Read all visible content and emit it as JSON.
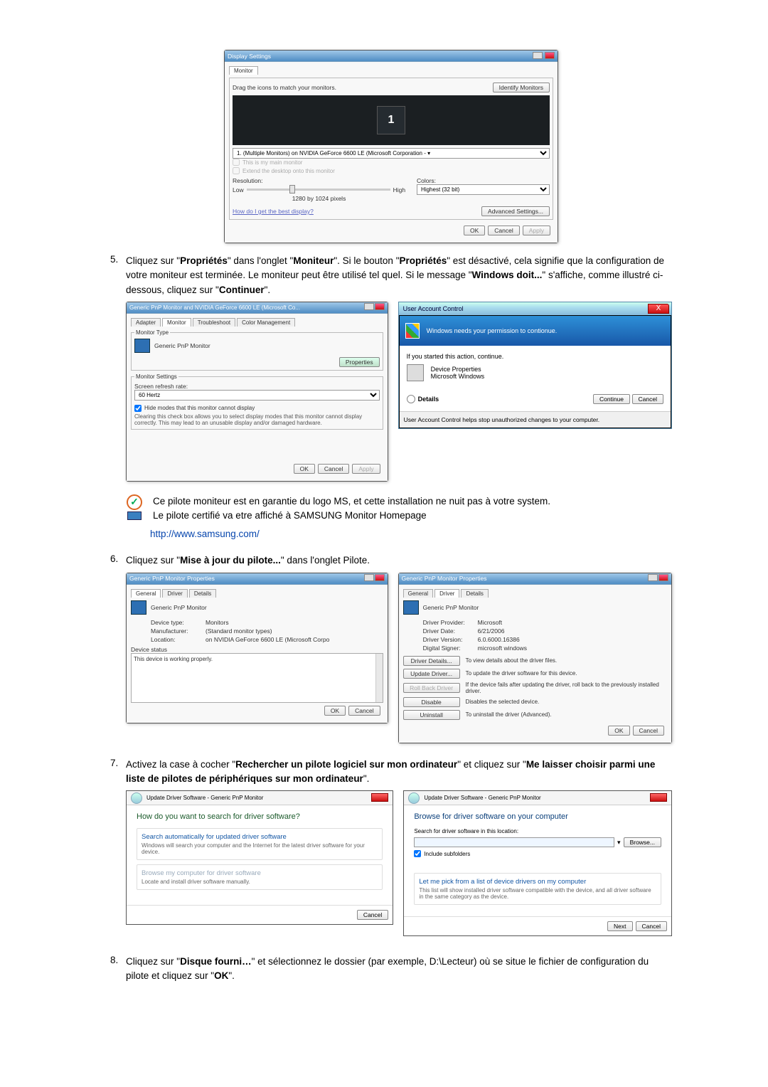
{
  "step4": {
    "screenshot": {
      "window_title": "Display Settings",
      "tab": "Monitor",
      "instruction": "Drag the icons to match your monitors.",
      "identify_btn": "Identify Monitors",
      "monitor_num": "1",
      "selector": "1. (Multiple Monitors) on NVIDIA GeForce 6600 LE (Microsoft Corporation - ▾",
      "chk_main": "This is my main monitor",
      "chk_extend": "Extend the desktop onto this monitor",
      "label_res": "Resolution:",
      "slider_low": "Low",
      "slider_high": "High",
      "res_value": "1280 by 1024 pixels",
      "label_colors": "Colors:",
      "colors_value": "Highest (32 bit)",
      "link_help": "How do I get the best display?",
      "adv_btn": "Advanced Settings...",
      "ok": "OK",
      "cancel": "Cancel",
      "apply": "Apply"
    }
  },
  "step5": {
    "num": "5.",
    "text_pre": "Cliquez sur \"",
    "b1": "Propriétés",
    "mid1": "\" dans l'onglet \"",
    "b2": "Moniteur",
    "mid2": "\". Si le bouton \"",
    "b3": "Propriétés",
    "mid3": "\" est désactivé, cela signifie que la configuration de votre moniteur est terminée. Le moniteur peut être utilisé tel quel. Si le message \"",
    "b4": "Windows doit...",
    "mid4": "\" s'affiche, comme illustré ci-dessous, cliquez sur \"",
    "b5": "Continuer",
    "end": "\".",
    "left": {
      "title": "Generic PnP Monitor and NVIDIA GeForce 6600 LE (Microsoft Co...",
      "tabs": [
        "Adapter",
        "Monitor",
        "Troubleshoot",
        "Color Management"
      ],
      "group_type": "Monitor Type",
      "mon_name": "Generic PnP Monitor",
      "prop_btn": "Properties",
      "group_settings": "Monitor Settings",
      "refresh_label": "Screen refresh rate:",
      "refresh_value": "60 Hertz",
      "chk_hide": "Hide modes that this monitor cannot display",
      "hide_desc": "Clearing this check box allows you to select display modes that this monitor cannot display correctly. This may lead to an unusable display and/or damaged hardware.",
      "ok": "OK",
      "cancel": "Cancel",
      "apply": "Apply"
    },
    "uac": {
      "titlebar": "User Account Control",
      "heading": "Windows needs your permission to contionue.",
      "if_you": "If you started this action, continue.",
      "item_label": "Device Properties",
      "item_sub": "Microsoft Windows",
      "details": "Details",
      "continue": "Continue",
      "cancel": "Cancel",
      "footer": "User Account Control helps stop unauthorized changes to your computer.",
      "x": "X"
    }
  },
  "note": {
    "line1": "Ce pilote moniteur est en garantie du logo MS, et cette installation ne nuit pas à votre system.",
    "line2": "Le pilote certifié va etre affiché à SAMSUNG Monitor Homepage"
  },
  "url": "http://www.samsung.com/",
  "step6": {
    "num": "6.",
    "text_pre": "Cliquez sur \"",
    "b1": "Mise à jour du pilote...",
    "end": "\" dans l'onglet Pilote.",
    "left": {
      "title": "Generic PnP Monitor Properties",
      "tabs": [
        "General",
        "Driver",
        "Details"
      ],
      "mon_name": "Generic PnP Monitor",
      "rows": {
        "devtype_l": "Device type:",
        "devtype_v": "Monitors",
        "manu_l": "Manufacturer:",
        "manu_v": "(Standard monitor types)",
        "loc_l": "Location:",
        "loc_v": "on NVIDIA GeForce 6600 LE (Microsoft Corpo"
      },
      "status_label": "Device status",
      "status_text": "This device is working properly.",
      "ok": "OK",
      "cancel": "Cancel"
    },
    "right": {
      "title": "Generic PnP Monitor Properties",
      "tabs": [
        "General",
        "Driver",
        "Details"
      ],
      "mon_name": "Generic PnP Monitor",
      "rows": {
        "prov_l": "Driver Provider:",
        "prov_v": "Microsoft",
        "date_l": "Driver Date:",
        "date_v": "6/21/2006",
        "ver_l": "Driver Version:",
        "ver_v": "6.0.6000.16386",
        "signer_l": "Digital Signer:",
        "signer_v": "microsoft windows"
      },
      "btns": {
        "details": "Driver Details...",
        "details_t": "To view details about the driver files.",
        "update": "Update Driver...",
        "update_t": "To update the driver software for this device.",
        "rollback": "Roll Back Driver",
        "rollback_t": "If the device fails after updating the driver, roll back to the previously installed driver.",
        "disable": "Disable",
        "disable_t": "Disables the selected device.",
        "uninstall": "Uninstall",
        "uninstall_t": "To uninstall the driver (Advanced)."
      },
      "ok": "OK",
      "cancel": "Cancel"
    }
  },
  "step7": {
    "num": "7.",
    "text_pre": "Activez la case à cocher \"",
    "b1": "Rechercher un pilote logiciel sur mon ordinateur",
    "mid": "\" et cliquez sur \"",
    "b2": "Me laisser choisir parmi une liste de pilotes de périphériques sur mon ordinateur",
    "end": "\".",
    "left": {
      "crumb": "Update Driver Software - Generic PnP Monitor",
      "heading": "How do you want to search for driver software?",
      "opt1_h": "Search automatically for updated driver software",
      "opt1_d": "Windows will search your computer and the Internet for the latest driver software for your device.",
      "opt2_h": "Browse my computer for driver software",
      "opt2_d": "Locate and install driver software manually.",
      "cancel": "Cancel"
    },
    "right": {
      "crumb": "Update Driver Software - Generic PnP Monitor",
      "heading": "Browse for driver software on your computer",
      "search_label": "Search for driver software in this location:",
      "browse": "Browse...",
      "chk_sub": "Include subfolders",
      "opt_h": "Let me pick from a list of device drivers on my computer",
      "opt_d": "This list will show installed driver software compatible with the device, and all driver software in the same category as the device.",
      "next": "Next",
      "cancel": "Cancel"
    }
  },
  "step8": {
    "num": "8.",
    "text_pre": "Cliquez sur \"",
    "b1": "Disque fourni…",
    "mid": "\" et sélectionnez le dossier (par exemple, D:\\Lecteur) où se situe le fichier de configuration du pilote et cliquez sur \"",
    "b2": "OK",
    "end": "\"."
  }
}
